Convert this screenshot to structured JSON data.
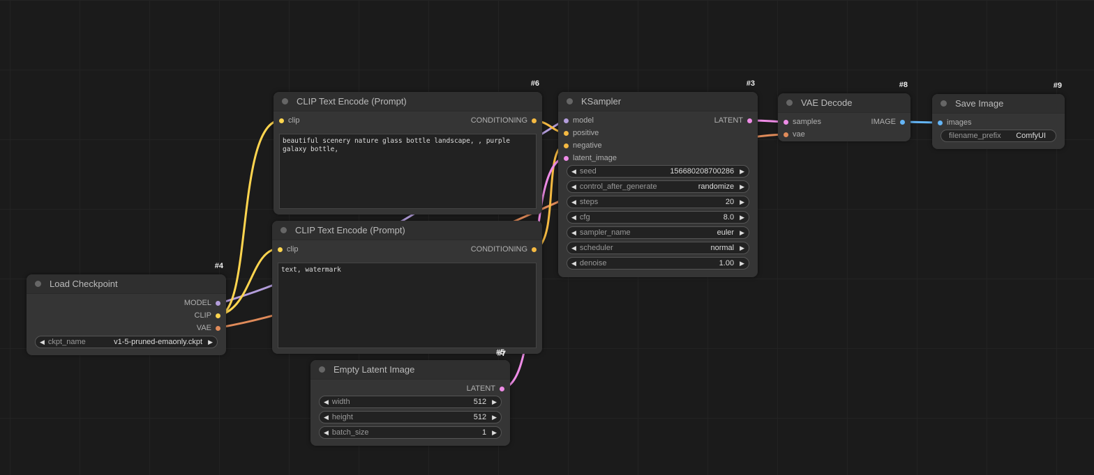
{
  "colors": {
    "model": "#b39ddb",
    "clip": "#ffd54f",
    "vae": "#e08b5a",
    "conditioning": "#f4b942",
    "latent": "#ee8ce6",
    "image": "#64b5f6"
  },
  "nodes": {
    "clip_pos": {
      "id": "#6",
      "title": "CLIP Text Encode (Prompt)",
      "input": "clip",
      "output": "CONDITIONING",
      "text": "beautiful scenery nature glass bottle landscape, , purple galaxy bottle,"
    },
    "clip_neg": {
      "id": "#7",
      "title": "CLIP Text Encode (Prompt)",
      "input": "clip",
      "output": "CONDITIONING",
      "text": "text, watermark"
    },
    "ksampler": {
      "id": "#3",
      "title": "KSampler",
      "inputs": [
        "model",
        "positive",
        "negative",
        "latent_image"
      ],
      "output": "LATENT",
      "widgets": [
        {
          "name": "seed",
          "value": "156680208700286"
        },
        {
          "name": "control_after_generate",
          "value": "randomize"
        },
        {
          "name": "steps",
          "value": "20"
        },
        {
          "name": "cfg",
          "value": "8.0"
        },
        {
          "name": "sampler_name",
          "value": "euler"
        },
        {
          "name": "scheduler",
          "value": "normal"
        },
        {
          "name": "denoise",
          "value": "1.00"
        }
      ]
    },
    "vae_decode": {
      "id": "#8",
      "title": "VAE Decode",
      "inputs": [
        "samples",
        "vae"
      ],
      "output": "IMAGE"
    },
    "save_image": {
      "id": "#9",
      "title": "Save Image",
      "input": "images",
      "widget": {
        "name": "filename_prefix",
        "value": "ComfyUI"
      }
    },
    "load_checkpoint": {
      "id": "#4",
      "title": "Load Checkpoint",
      "outputs": [
        "MODEL",
        "CLIP",
        "VAE"
      ],
      "widget": {
        "name": "ckpt_name",
        "value": "v1-5-pruned-emaonly.ckpt"
      }
    },
    "empty_latent": {
      "id": "#5",
      "title": "Empty Latent Image",
      "output": "LATENT",
      "widgets": [
        {
          "name": "width",
          "value": "512"
        },
        {
          "name": "height",
          "value": "512"
        },
        {
          "name": "batch_size",
          "value": "1"
        }
      ]
    }
  }
}
